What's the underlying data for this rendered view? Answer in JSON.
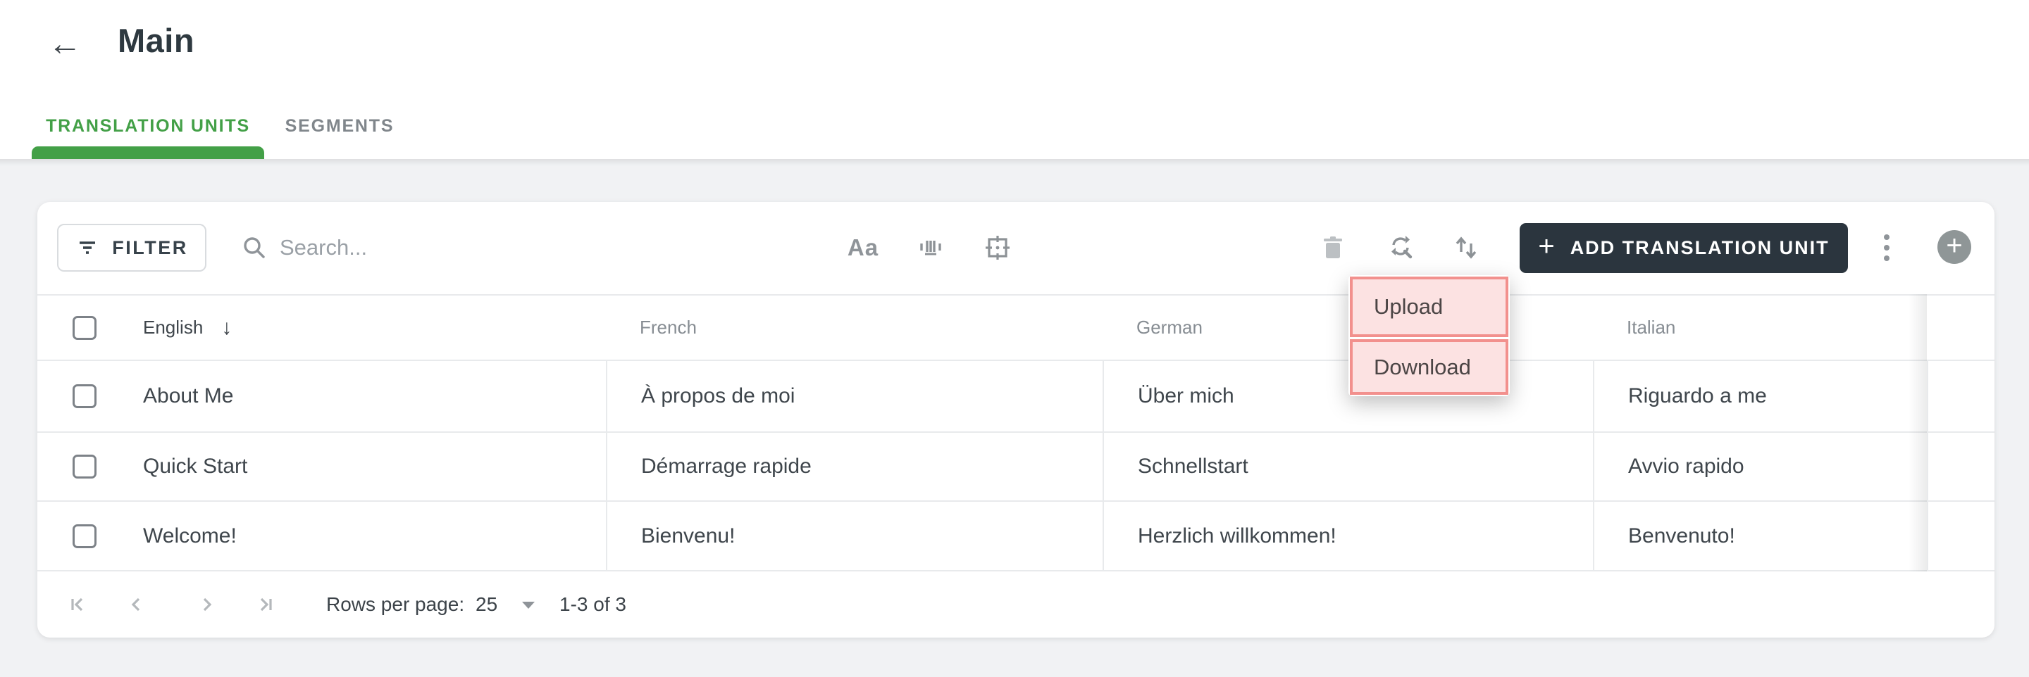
{
  "header": {
    "title": "Main",
    "tabs": [
      {
        "label": "TRANSLATION UNITS",
        "active": true
      },
      {
        "label": "SEGMENTS",
        "active": false
      }
    ]
  },
  "icons": {
    "back_arrow": "←",
    "sort_desc": "↓",
    "case_toggle": "Aa",
    "fab_plus": "+",
    "add_plus": "+"
  },
  "toolbar": {
    "filter_label": "FILTER",
    "search_placeholder": "Search...",
    "add_button_label": "ADD TRANSLATION UNIT"
  },
  "menu": {
    "items": [
      {
        "label": "Upload"
      },
      {
        "label": "Download"
      }
    ]
  },
  "table": {
    "columns": [
      {
        "label": "English",
        "sorted": "desc"
      },
      {
        "label": "French"
      },
      {
        "label": "German"
      },
      {
        "label": "Italian"
      }
    ],
    "rows": [
      [
        "About Me",
        "À propos de moi",
        "Über mich",
        "Riguardo a me"
      ],
      [
        "Quick Start",
        "Démarrage rapide",
        "Schnellstart",
        "Avvio rapido"
      ],
      [
        "Welcome!",
        "Bienvenu!",
        "Herzlich willkommen!",
        "Benvenuto!"
      ]
    ]
  },
  "footer": {
    "rows_per_page_label": "Rows per page:",
    "rows_per_page_value": "25",
    "range_label": "1-3 of 3"
  },
  "colors": {
    "accent_green": "#43a047",
    "dark_button": "#2b353e",
    "highlight_fill": "#fce2e2",
    "highlight_border": "#f2908d",
    "page_background": "#f1f2f4"
  }
}
